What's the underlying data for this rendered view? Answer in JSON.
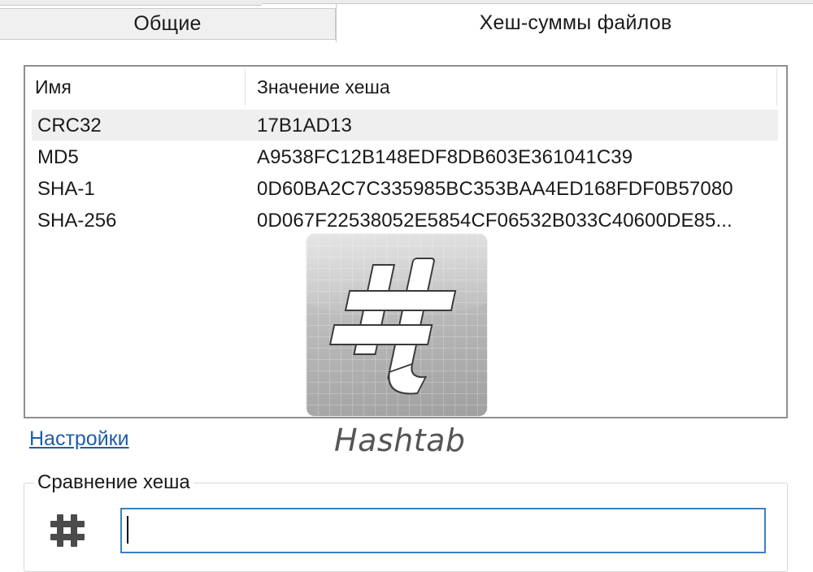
{
  "tabs": [
    {
      "label": "Общие",
      "active": false
    },
    {
      "label": "Хеш-суммы файлов",
      "active": true
    }
  ],
  "hash_table": {
    "columns": [
      "Имя",
      "Значение хеша"
    ],
    "rows": [
      {
        "name": "CRC32",
        "value": "17B1AD13",
        "selected": true
      },
      {
        "name": "MD5",
        "value": "A9538FC12B148EDF8DB603E361041C39",
        "selected": false
      },
      {
        "name": "SHA-1",
        "value": "0D60BA2C7C335985BC353BAA4ED168FDF0B57080",
        "selected": false
      },
      {
        "name": "SHA-256",
        "value": "0D067F22538052E5854CF06532B033C40600DE85...",
        "selected": false
      }
    ]
  },
  "logo": {
    "wordmark": "Hashtab",
    "icon": "hashtab-logo-icon"
  },
  "settings_link": "Настройки",
  "compare": {
    "title": "Сравнение хеша",
    "input_value": "",
    "icon": "hash-icon"
  },
  "colors": {
    "link": "#1f5ea8",
    "input_border": "#3c7fc1",
    "selected_row": "#efefef"
  }
}
